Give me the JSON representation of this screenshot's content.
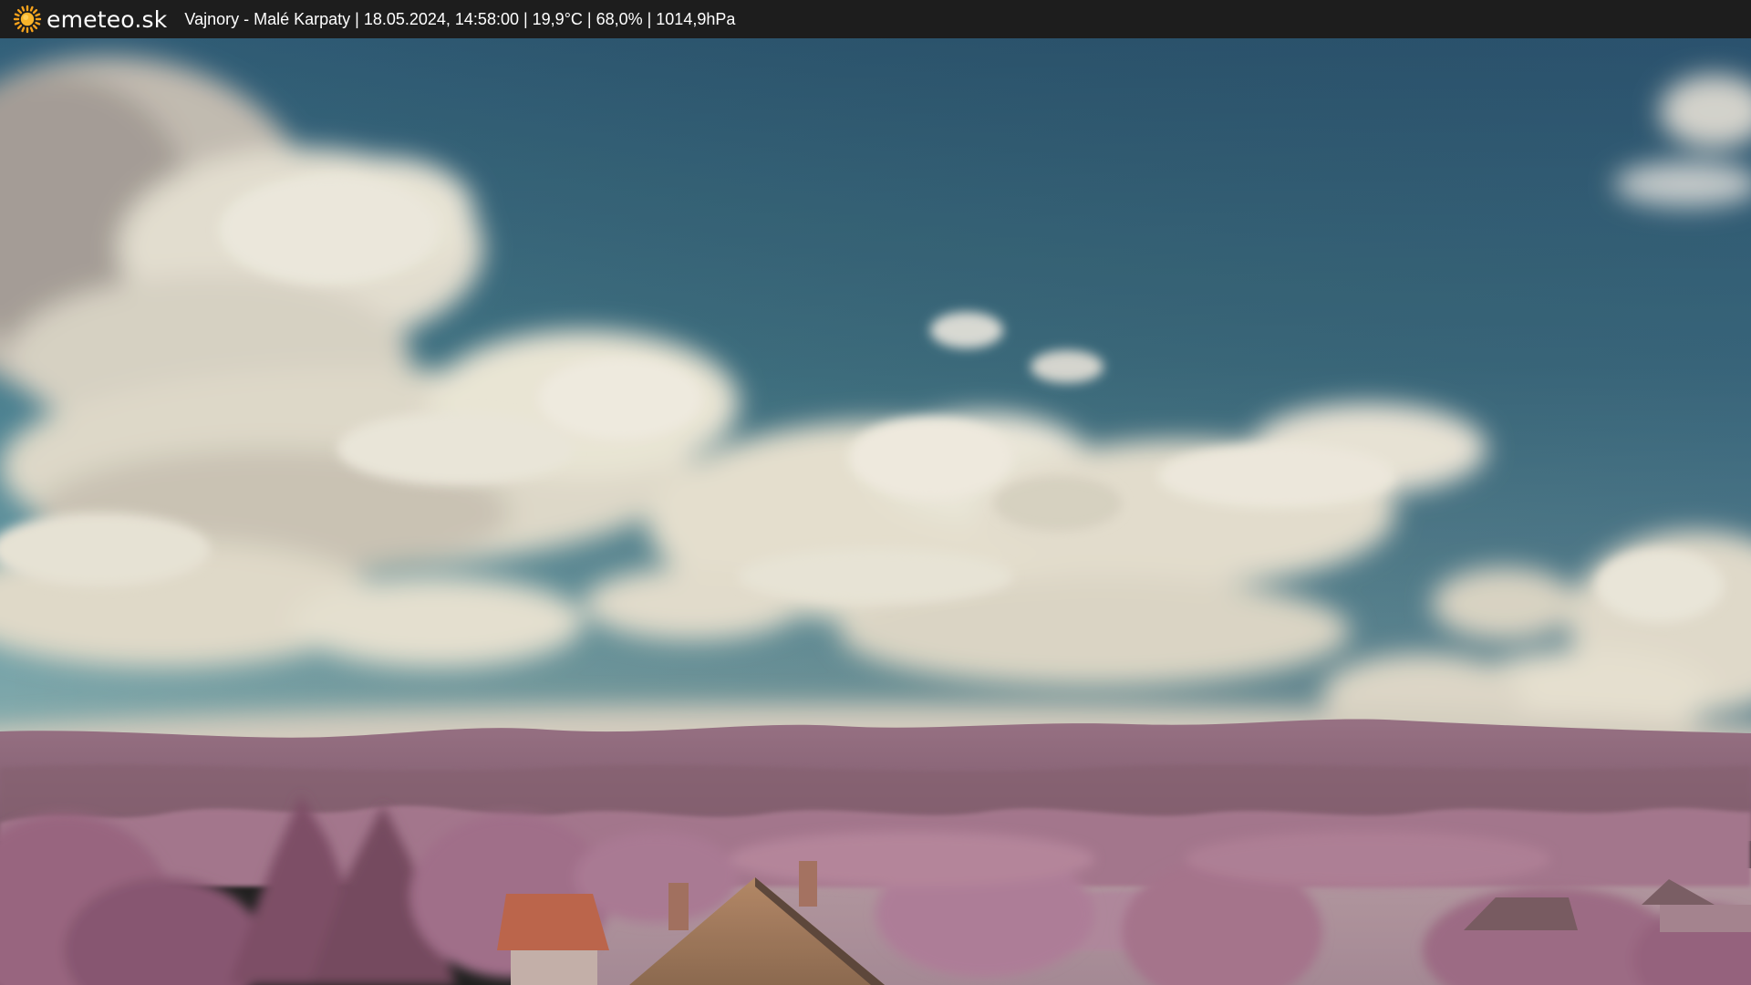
{
  "header": {
    "brand": "emeteo.sk",
    "info": "Vajnory - Malé Karpaty | 18.05.2024, 14:58:00 | 19,9°C | 68,0% | 1014,9hPa",
    "logo_icon": "sun-icon"
  },
  "colors": {
    "bar": "#1d1d1d",
    "sun": "#f6a21c",
    "sky_top": "#2e5a76",
    "sky_bottom": "#6ea3ad",
    "cloud": "#ece7d6",
    "foliage": "#a36f8c",
    "hills": "#8f6478",
    "roof": "#b96a4e"
  },
  "scene": {
    "description_icon": "webcam-landscape"
  }
}
